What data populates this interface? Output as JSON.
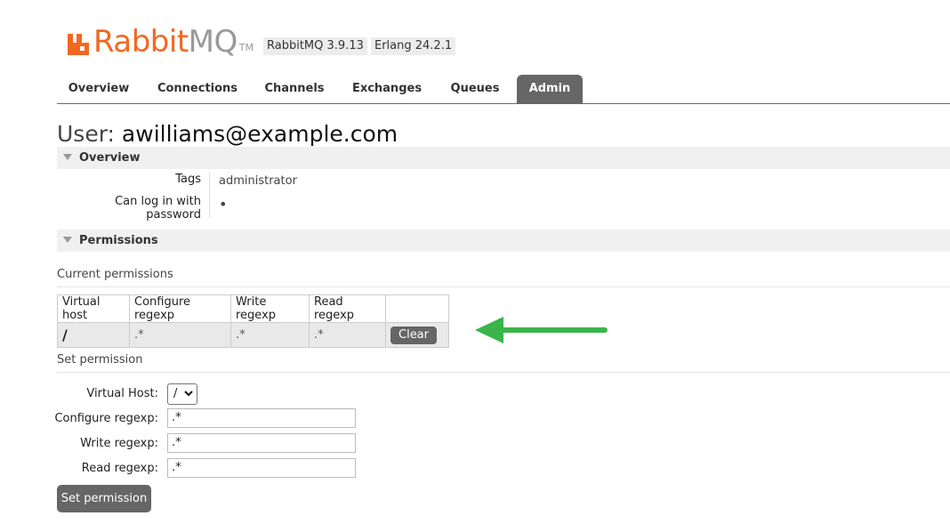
{
  "header": {
    "logo_rabbit": "Rabbit",
    "logo_mq": "MQ",
    "logo_tm": "TM",
    "rabbitmq_version": "RabbitMQ 3.9.13",
    "erlang_version": "Erlang 24.2.1",
    "brand_color": "#f26822"
  },
  "tabs": [
    {
      "label": "Overview",
      "active": false
    },
    {
      "label": "Connections",
      "active": false
    },
    {
      "label": "Channels",
      "active": false
    },
    {
      "label": "Exchanges",
      "active": false
    },
    {
      "label": "Queues",
      "active": false
    },
    {
      "label": "Admin",
      "active": true
    }
  ],
  "page": {
    "title_prefix": "User:",
    "user_name": "awilliams@example.com"
  },
  "overview": {
    "section_label": "Overview",
    "tags_label": "Tags",
    "tags_value": "administrator",
    "can_login_label": "Can log in with password",
    "can_login_value": "•"
  },
  "permissions": {
    "section_label": "Permissions",
    "current_label": "Current permissions",
    "columns": [
      "Virtual host",
      "Configure regexp",
      "Write regexp",
      "Read regexp"
    ],
    "rows": [
      {
        "vhost": "/",
        "configure": ".*",
        "write": ".*",
        "read": ".*",
        "action": "Clear"
      }
    ]
  },
  "set_permission": {
    "section_label": "Set permission",
    "vhost_label": "Virtual Host:",
    "vhost_value": "/",
    "configure_label": "Configure regexp:",
    "configure_value": ".*",
    "write_label": "Write regexp:",
    "write_value": ".*",
    "read_label": "Read regexp:",
    "read_value": ".*",
    "submit_label": "Set permission"
  },
  "annotation": {
    "arrow_color": "#3ab54a",
    "arrow_icon": "arrow-left-icon"
  }
}
